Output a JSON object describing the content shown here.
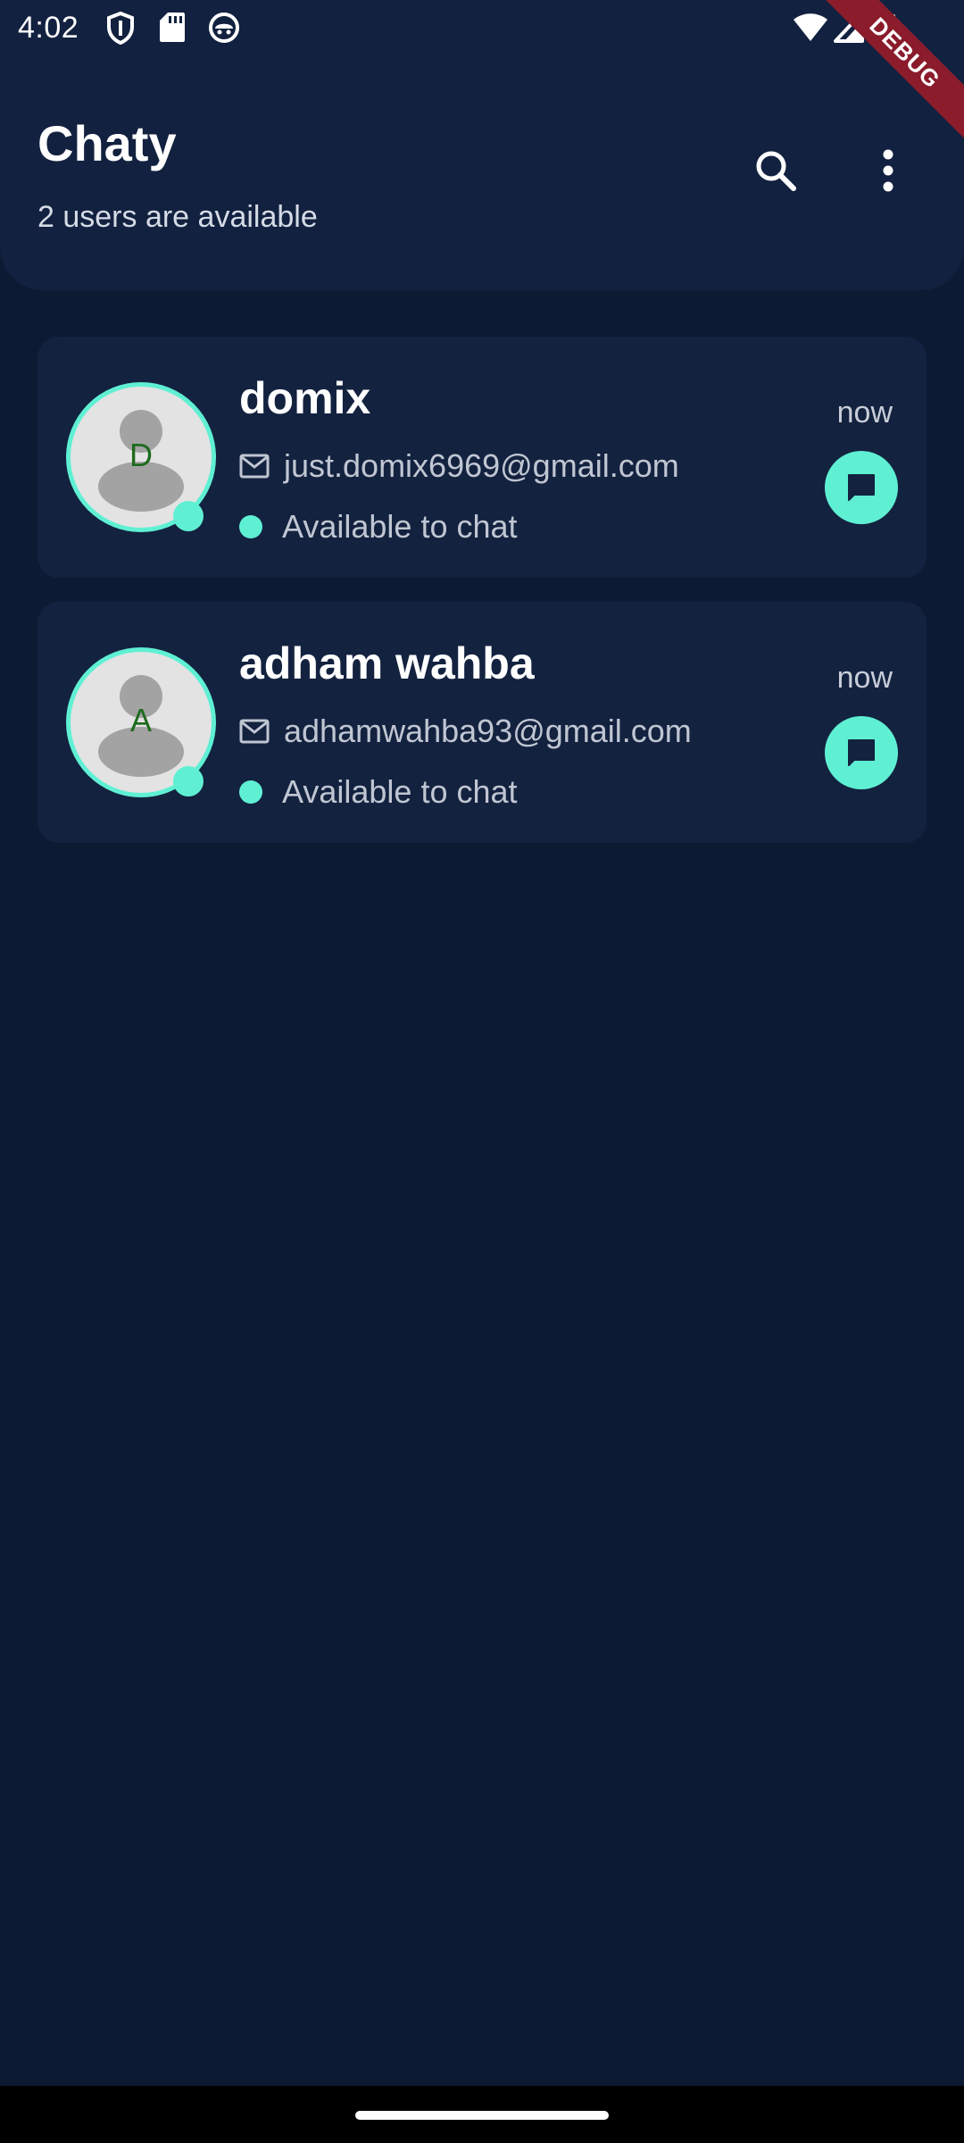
{
  "status_bar": {
    "time": "4:02",
    "icons": [
      "shield-icon",
      "sd-card-icon",
      "android-debug-icon",
      "wifi-icon",
      "cellular-signal-icon",
      "battery-icon"
    ]
  },
  "debug_banner": {
    "label": "DEBUG"
  },
  "app_bar": {
    "title": "Chaty",
    "subtitle": "2 users are available",
    "actions": [
      "search-icon",
      "more-vert-icon"
    ]
  },
  "colors": {
    "background": "#0c1a33",
    "surface": "#13223f",
    "accent": "#5ff0d4",
    "debug_ribbon": "#8a1c2c"
  },
  "users": [
    {
      "initial": "D",
      "name": "domix",
      "email": "just.domix6969@gmail.com",
      "status": "Available to chat",
      "time": "now"
    },
    {
      "initial": "A",
      "name": "adham wahba",
      "email": "adhamwahba93@gmail.com",
      "status": "Available to chat",
      "time": "now"
    }
  ]
}
